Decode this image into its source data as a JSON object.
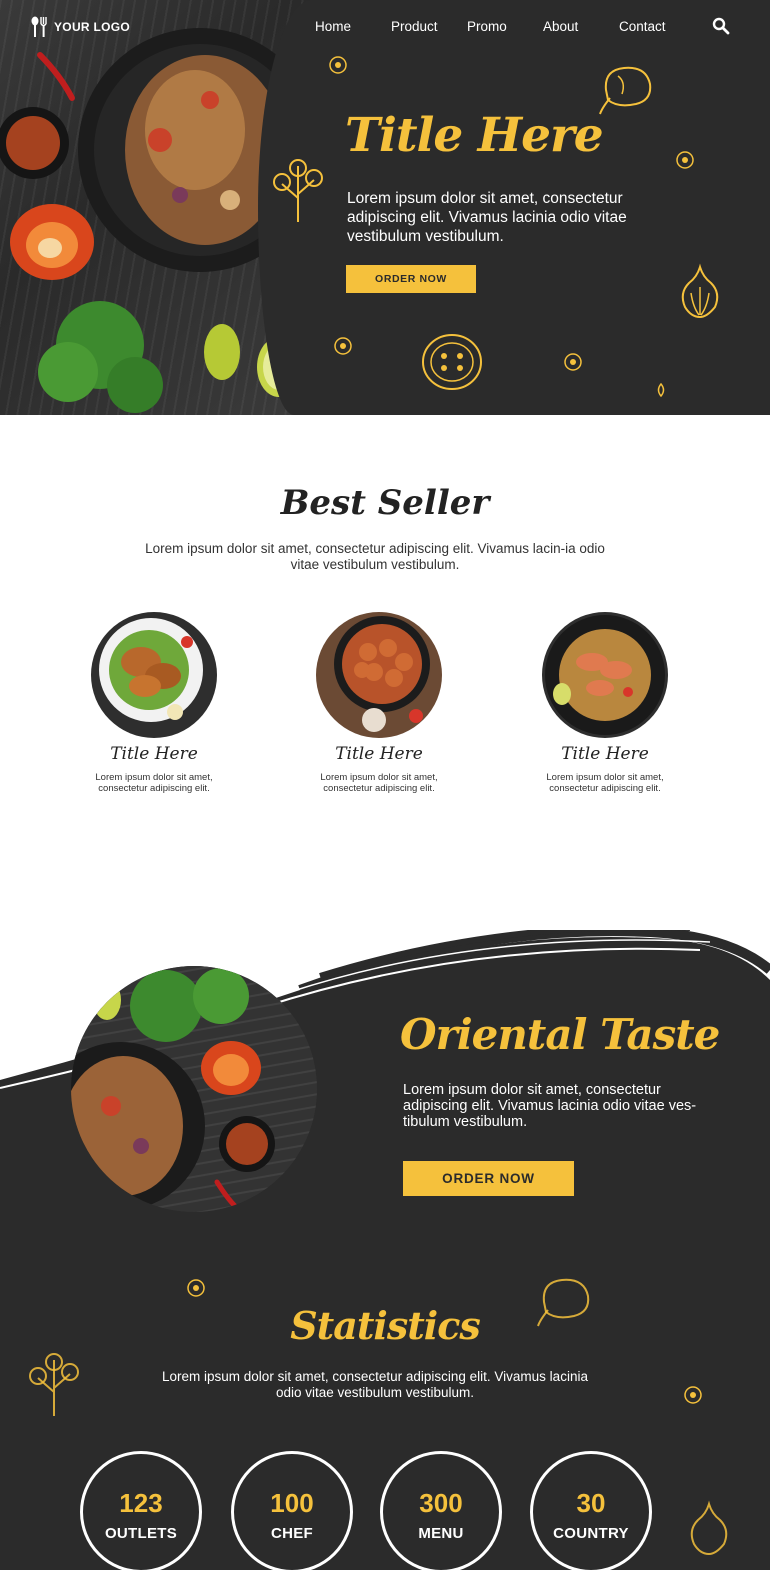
{
  "brand": {
    "logo_text": "YOUR LOGO"
  },
  "nav": {
    "items": [
      {
        "label": "Home"
      },
      {
        "label": "Product"
      },
      {
        "label": "Promo"
      },
      {
        "label": "About"
      },
      {
        "label": "Contact"
      }
    ],
    "search_icon": "search-icon"
  },
  "hero": {
    "title": "Title Here",
    "text": "Lorem ipsum dolor sit amet, consectetur adipiscing elit. Vivamus lacinia odio vitae vestibulum vestibulum.",
    "button_label": "ORDER NOW"
  },
  "best_seller": {
    "title": "Best Seller",
    "text": "Lorem ipsum dolor sit amet, consectetur adipiscing elit. Vivamus lacin-ia odio vitae vestibulum vestibulum.",
    "items": [
      {
        "title": "Title Here",
        "text": "Lorem ipsum dolor sit amet, consectetur adipiscing elit."
      },
      {
        "title": "Title Here",
        "text": "Lorem ipsum dolor sit amet, consectetur adipiscing elit."
      },
      {
        "title": "Title Here",
        "text": "Lorem ipsum dolor sit amet, consectetur adipiscing elit."
      }
    ]
  },
  "oriental": {
    "title": "Oriental Taste",
    "text": "Lorem ipsum dolor sit amet, consectetur adipiscing elit. Vivamus lacinia odio vitae ves-tibulum vestibulum.",
    "button_label": "ORDER NOW"
  },
  "statistics": {
    "title": "Statistics",
    "text": "Lorem ipsum dolor sit amet, consectetur adipiscing elit. Vivamus lacinia odio vitae vestibulum vestibulum.",
    "items": [
      {
        "value": "123",
        "label": "OUTLETS"
      },
      {
        "value": "100",
        "label": "CHEF"
      },
      {
        "value": "300",
        "label": "MENU"
      },
      {
        "value": "30",
        "label": "COUNTRY"
      }
    ]
  },
  "colors": {
    "accent": "#f5c13c",
    "dark": "#2b2b2b",
    "light": "#ffffff"
  }
}
